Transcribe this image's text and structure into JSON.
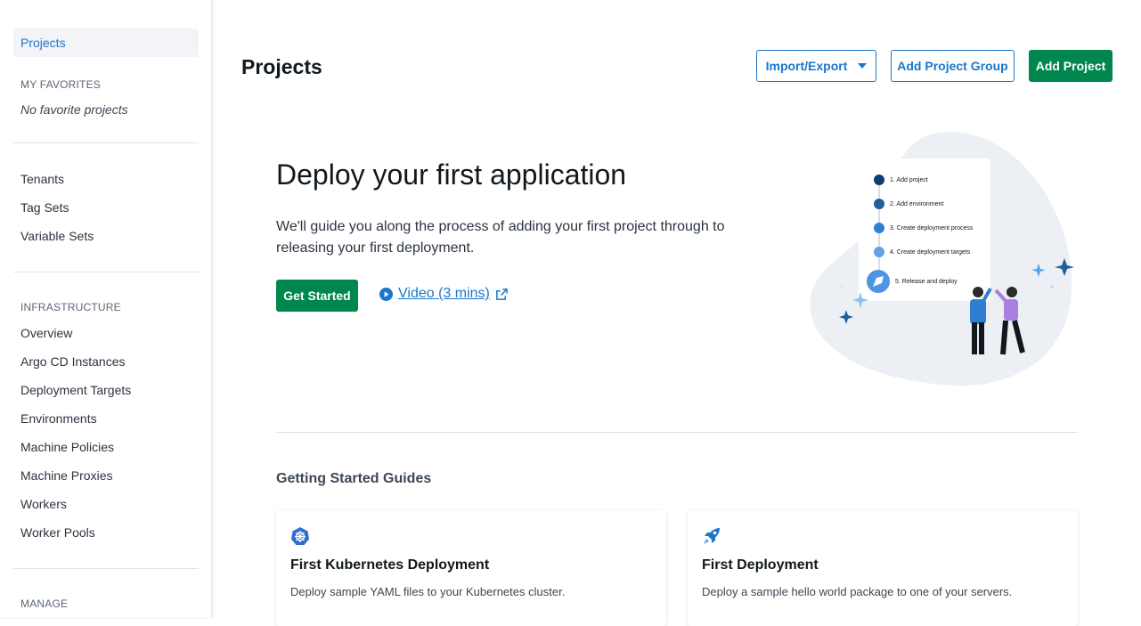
{
  "sidebar": {
    "active_item": "Projects",
    "favorites_heading": "MY FAVORITES",
    "favorites_empty": "No favorite projects",
    "library_items": [
      "Tenants",
      "Tag Sets",
      "Variable Sets"
    ],
    "infrastructure_heading": "INFRASTRUCTURE",
    "infrastructure_items": [
      "Overview",
      "Argo CD Instances",
      "Deployment Targets",
      "Environments",
      "Machine Policies",
      "Machine Proxies",
      "Workers",
      "Worker Pools"
    ],
    "manage_heading": "MANAGE"
  },
  "header": {
    "title": "Projects",
    "import_export_label": "Import/Export",
    "add_group_label": "Add Project Group",
    "add_project_label": "Add Project"
  },
  "hero": {
    "title": "Deploy your first application",
    "description": "We'll guide you along the process of adding your first project through to releasing your first deployment.",
    "get_started_label": "Get Started",
    "video_label": "Video (3 mins)",
    "steps": [
      "1. Add project",
      "2. Add environment",
      "3. Create deployment process",
      "4. Create deployment targets",
      "5. Release and deploy"
    ]
  },
  "guides": {
    "heading": "Getting Started Guides",
    "cards": [
      {
        "title": "First Kubernetes Deployment",
        "description": "Deploy sample YAML files to your Kubernetes cluster.",
        "icon": "kubernetes-icon"
      },
      {
        "title": "First Deployment",
        "description": "Deploy a sample hello world package to one of your servers.",
        "icon": "rocket-icon"
      }
    ]
  },
  "colors": {
    "accent": "#1a77ca",
    "primary_green": "#00874d",
    "sidebar_active_bg": "#f2f4f7"
  }
}
